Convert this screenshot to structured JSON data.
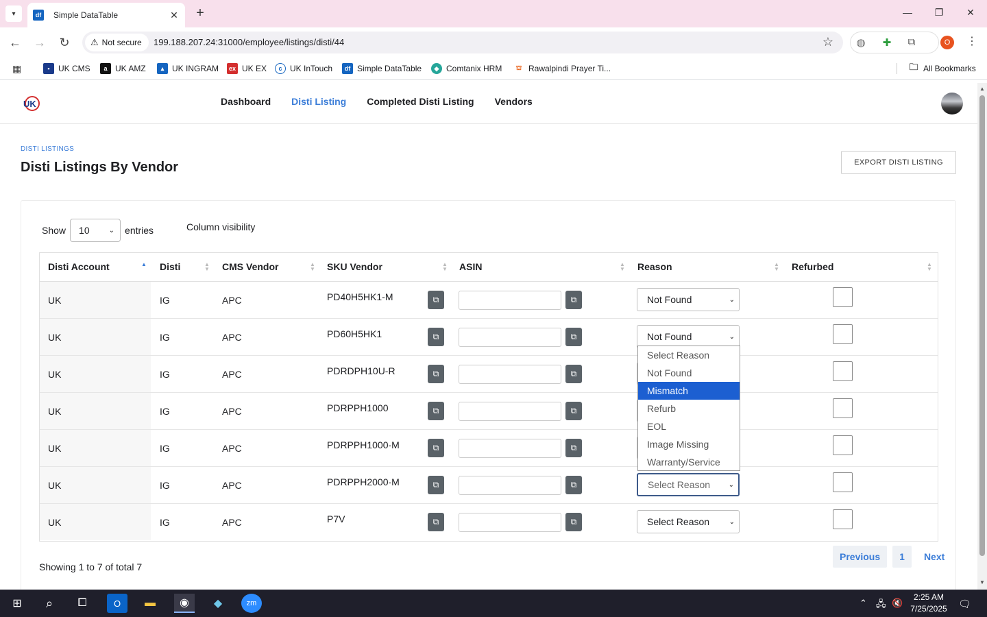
{
  "browser": {
    "tab_title": "Simple DataTable",
    "tab_favicon": "df",
    "security_label": "Not secure",
    "url": "199.188.207.24:31000/employee/listings/disti/44",
    "bookmarks": [
      {
        "label": "UK CMS",
        "icon": "cms-favicon",
        "color": "#1a3a8a"
      },
      {
        "label": "UK AMZ",
        "icon": "amazon-favicon",
        "color": "#111111"
      },
      {
        "label": "UK INGRAM",
        "icon": "ingram-favicon",
        "color": "#1565c0"
      },
      {
        "label": "UK EX",
        "icon": "ex-favicon",
        "color": "#d32f2f"
      },
      {
        "label": "UK InTouch",
        "icon": "intouch-favicon",
        "color": "#1565c0"
      },
      {
        "label": "Simple DataTable",
        "icon": "df-favicon",
        "color": "#1565c0"
      },
      {
        "label": "Comtanix HRM",
        "icon": "hrm-favicon",
        "color": "#26a69a"
      },
      {
        "label": "Rawalpindi Prayer Ti...",
        "icon": "prayer-favicon",
        "color": "#e65100"
      }
    ],
    "all_bookmarks": "All Bookmarks",
    "profile_initial": "O"
  },
  "app": {
    "nav": [
      "Dashboard",
      "Disti Listing",
      "Completed Disti Listing",
      "Vendors"
    ],
    "active_nav": "Disti Listing",
    "accent": "#3b7dd8"
  },
  "page": {
    "breadcrumb": "DISTI LISTINGS",
    "title": "Disti Listings By Vendor",
    "export_label": "EXPORT DISTI LISTING"
  },
  "table": {
    "show_label": "Show",
    "entries_value": "10",
    "entries_label": "entries",
    "column_visibility": "Column visibility",
    "columns": [
      "Disti Account",
      "Disti",
      "CMS Vendor",
      "SKU Vendor",
      "ASIN",
      "Reason",
      "Refurbed"
    ],
    "rows": [
      {
        "account": "UK",
        "disti": "IG",
        "vendor": "APC",
        "sku": "PD40H5HK1-M",
        "reason": "Not Found"
      },
      {
        "account": "UK",
        "disti": "IG",
        "vendor": "APC",
        "sku": "PD60H5HK1",
        "reason": "Not Found"
      },
      {
        "account": "UK",
        "disti": "IG",
        "vendor": "APC",
        "sku": "PDRDPH10U-R",
        "reason": ""
      },
      {
        "account": "UK",
        "disti": "IG",
        "vendor": "APC",
        "sku": "PDRPPH1000",
        "reason": ""
      },
      {
        "account": "UK",
        "disti": "IG",
        "vendor": "APC",
        "sku": "PDRPPH1000-M",
        "reason": ""
      },
      {
        "account": "UK",
        "disti": "IG",
        "vendor": "APC",
        "sku": "PDRPPH2000-M",
        "reason": "Select Reason"
      },
      {
        "account": "UK",
        "disti": "IG",
        "vendor": "APC",
        "sku": "P7V",
        "reason": "Select Reason"
      }
    ],
    "reason_options": [
      "Select Reason",
      "Not Found",
      "Mismatch",
      "Refurb",
      "EOL",
      "Image Missing",
      "Warranty/Service"
    ],
    "highlighted_option": "Mismatch",
    "info": "Showing 1 to 7 of total 7",
    "prev": "Previous",
    "page": "1",
    "next": "Next"
  },
  "taskbar": {
    "time": "2:25 AM",
    "date": "7/25/2025"
  }
}
